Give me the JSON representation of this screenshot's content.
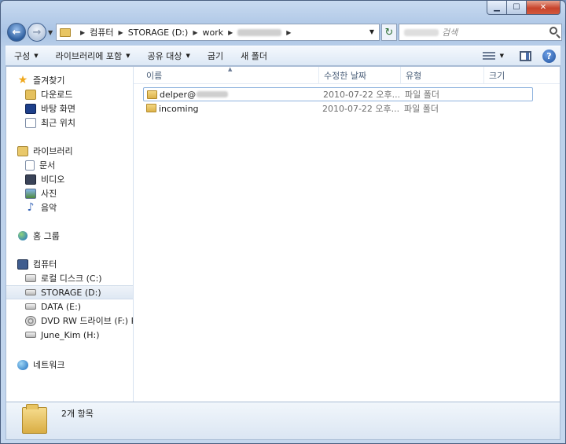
{
  "caption": {
    "minimize": "▁",
    "maximize": "☐",
    "close": "✕"
  },
  "address": {
    "crumbs": [
      "컴퓨터",
      "STORAGE (D:)",
      "work"
    ],
    "search_placeholder": "검색"
  },
  "toolbar": {
    "organize": "구성",
    "include_library": "라이브러리에 포함",
    "share": "공유 대상",
    "burn": "굽기",
    "new_folder": "새 폴더"
  },
  "nav": {
    "favorites": "즐겨찾기",
    "downloads": "다운로드",
    "desktop": "바탕 화면",
    "recent": "최근 위치",
    "libraries": "라이브러리",
    "documents": "문서",
    "videos": "비디오",
    "pictures": "사진",
    "music": "음악",
    "homegroup": "홈 그룹",
    "computer": "컴퓨터",
    "drive_c": "로컬 디스크 (C:)",
    "drive_d": "STORAGE (D:)",
    "drive_e": "DATA (E:)",
    "drive_f": "DVD RW 드라이브 (F:) RI",
    "drive_h": "June_Kim (H:)",
    "network": "네트워크"
  },
  "columns": {
    "name": "이름",
    "modified": "수정한 날짜",
    "type": "유형",
    "size": "크기"
  },
  "files": [
    {
      "name": "delper@",
      "modified": "2010-07-22 오후...",
      "type": "파일 폴더"
    },
    {
      "name": "incoming",
      "modified": "2010-07-22 오후...",
      "type": "파일 폴더"
    }
  ],
  "details": {
    "count": "2개 항목"
  }
}
